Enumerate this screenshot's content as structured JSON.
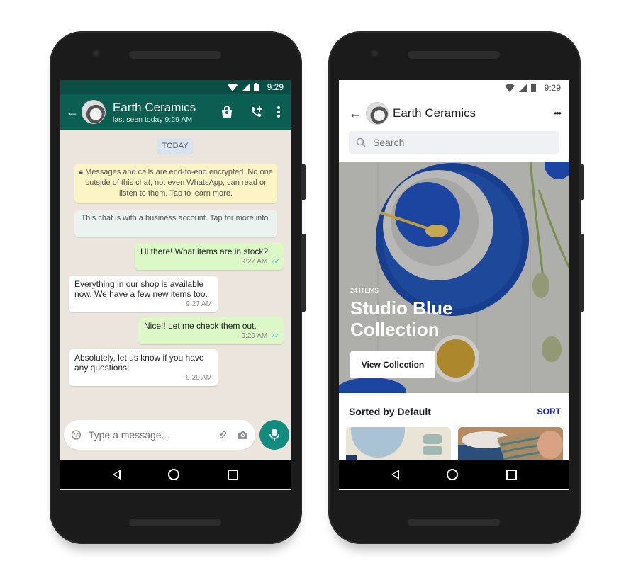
{
  "left_phone": {
    "status_bar": {
      "time": "9:29",
      "icons": [
        "wifi-icon",
        "signal-icon",
        "battery-icon"
      ]
    },
    "header": {
      "back_icon": "arrow-left-icon",
      "title": "Earth Ceramics",
      "subtitle": "last seen today 9:29 AM",
      "actions": [
        "shopping-bag-icon",
        "add-call-icon",
        "more-vertical-icon"
      ]
    },
    "date_chip": "TODAY",
    "encryption_notice": "Messages and calls are end-to-end encrypted. No one outside of this chat, not even WhatsApp, can read or listen to them. Tap to learn more.",
    "business_notice": "This chat is with a business account. Tap for more info.",
    "messages": [
      {
        "direction": "outgoing",
        "text": "Hi there! What items are in stock?",
        "time": "9:27 AM",
        "status": "read"
      },
      {
        "direction": "incoming",
        "text": "Everything in our shop is available now. We have a few new items too.",
        "time": "9:27 AM"
      },
      {
        "direction": "outgoing",
        "text": "Nice!! Let me check them out.",
        "time": "9:29 AM",
        "status": "read"
      },
      {
        "direction": "incoming",
        "text": "Absolutely, let us know if you have any questions!",
        "time": "9:29 AM"
      }
    ],
    "composer": {
      "placeholder": "Type a message...",
      "icons": [
        "emoji-icon",
        "paperclip-icon",
        "camera-icon",
        "microphone-icon"
      ]
    },
    "colors": {
      "header": "#0a5f52",
      "outgoing": "#dcf8c6",
      "accent": "#128c7e",
      "chat_bg": "#ece5dd"
    }
  },
  "right_phone": {
    "status_bar": {
      "time": "9:29"
    },
    "header": {
      "title": "Earth Ceramics",
      "more_label": "•••"
    },
    "search": {
      "placeholder": "Search"
    },
    "hero": {
      "count": "24 ITEMS",
      "title_line1": "Studio Blue",
      "title_line2": "Collection",
      "button": "View Collection"
    },
    "sort": {
      "label": "Sorted by Default",
      "action": "SORT"
    },
    "colors": {
      "sort_action": "#1a19b8"
    }
  },
  "nav_bar": {
    "icons": [
      "back-triangle-icon",
      "home-circle-icon",
      "recents-square-icon"
    ]
  }
}
